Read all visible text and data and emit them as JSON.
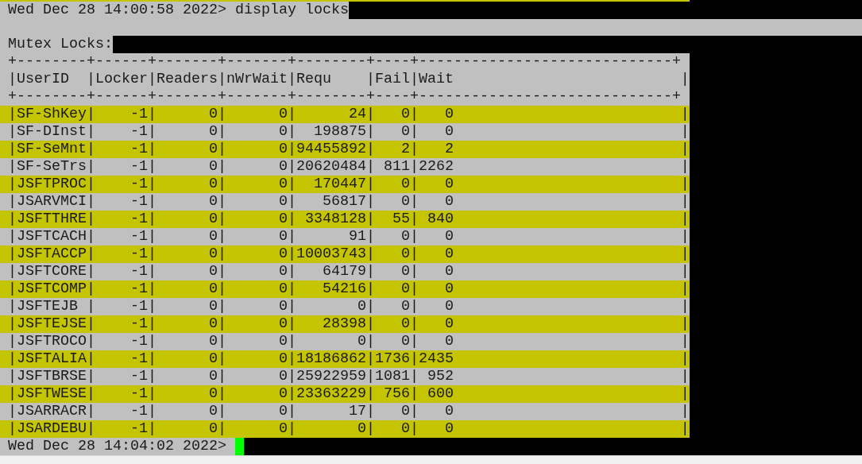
{
  "command_line": {
    "text": "Wed Dec 28 14:00:58 2022> display locks"
  },
  "section_title": "Mutex Locks:",
  "table": {
    "border_top": "+--------+------+-------+-------+--------+----+-----------------------------+",
    "separator": "|",
    "columns": [
      "UserID",
      "Locker",
      "Readers",
      "nWrWait",
      "Requ",
      "Fail",
      "Wait"
    ],
    "header_rule": "+--------+------+-------+-------+--------+----+-----------------------------+",
    "rows": [
      {
        "highlighted": true,
        "cells": [
          "SF-ShKey",
          "-1",
          "0",
          "0",
          "24",
          "0",
          "0"
        ]
      },
      {
        "highlighted": false,
        "cells": [
          "SF-DInst",
          "-1",
          "0",
          "0",
          "198875",
          "0",
          "0"
        ]
      },
      {
        "highlighted": true,
        "cells": [
          "SF-SeMnt",
          "-1",
          "0",
          "0",
          "94455892",
          "2",
          "2"
        ]
      },
      {
        "highlighted": false,
        "cells": [
          "SF-SeTrs",
          "-1",
          "0",
          "0",
          "20620484",
          "811",
          "2262"
        ]
      },
      {
        "highlighted": true,
        "cells": [
          "JSFTPROC",
          "-1",
          "0",
          "0",
          "170447",
          "0",
          "0"
        ]
      },
      {
        "highlighted": false,
        "cells": [
          "JSARVMCI",
          "-1",
          "0",
          "0",
          "56817",
          "0",
          "0"
        ]
      },
      {
        "highlighted": true,
        "cells": [
          "JSFTTHRE",
          "-1",
          "0",
          "0",
          "3348128",
          "55",
          "840"
        ]
      },
      {
        "highlighted": false,
        "cells": [
          "JSFTCACH",
          "-1",
          "0",
          "0",
          "91",
          "0",
          "0"
        ]
      },
      {
        "highlighted": true,
        "cells": [
          "JSFTACCP",
          "-1",
          "0",
          "0",
          "10003743",
          "0",
          "0"
        ]
      },
      {
        "highlighted": false,
        "cells": [
          "JSFTCORE",
          "-1",
          "0",
          "0",
          "64179",
          "0",
          "0"
        ]
      },
      {
        "highlighted": true,
        "cells": [
          "JSFTCOMP",
          "-1",
          "0",
          "0",
          "54216",
          "0",
          "0"
        ]
      },
      {
        "highlighted": false,
        "cells": [
          "JSFTEJB",
          "-1",
          "0",
          "0",
          "0",
          "0",
          "0"
        ]
      },
      {
        "highlighted": true,
        "cells": [
          "JSFTEJSE",
          "-1",
          "0",
          "0",
          "28398",
          "0",
          "0"
        ]
      },
      {
        "highlighted": false,
        "cells": [
          "JSFTROCO",
          "-1",
          "0",
          "0",
          "0",
          "0",
          "0"
        ]
      },
      {
        "highlighted": true,
        "cells": [
          "JSFTALIA",
          "-1",
          "0",
          "0",
          "18186862",
          "1736",
          "2435"
        ]
      },
      {
        "highlighted": false,
        "cells": [
          "JSFTBRSE",
          "-1",
          "0",
          "0",
          "25922959",
          "1081",
          "952"
        ]
      },
      {
        "highlighted": true,
        "cells": [
          "JSFTWESE",
          "-1",
          "0",
          "0",
          "23363229",
          "756",
          "600"
        ]
      },
      {
        "highlighted": false,
        "cells": [
          "JSARRACR",
          "-1",
          "0",
          "0",
          "17",
          "0",
          "0"
        ]
      },
      {
        "highlighted": true,
        "cells": [
          "JSARDEBU",
          "-1",
          "0",
          "0",
          "0",
          "0",
          "0"
        ]
      }
    ]
  },
  "prompt_line": {
    "text": "Wed Dec 28 14:04:02 2022>",
    "cursor": true
  }
}
